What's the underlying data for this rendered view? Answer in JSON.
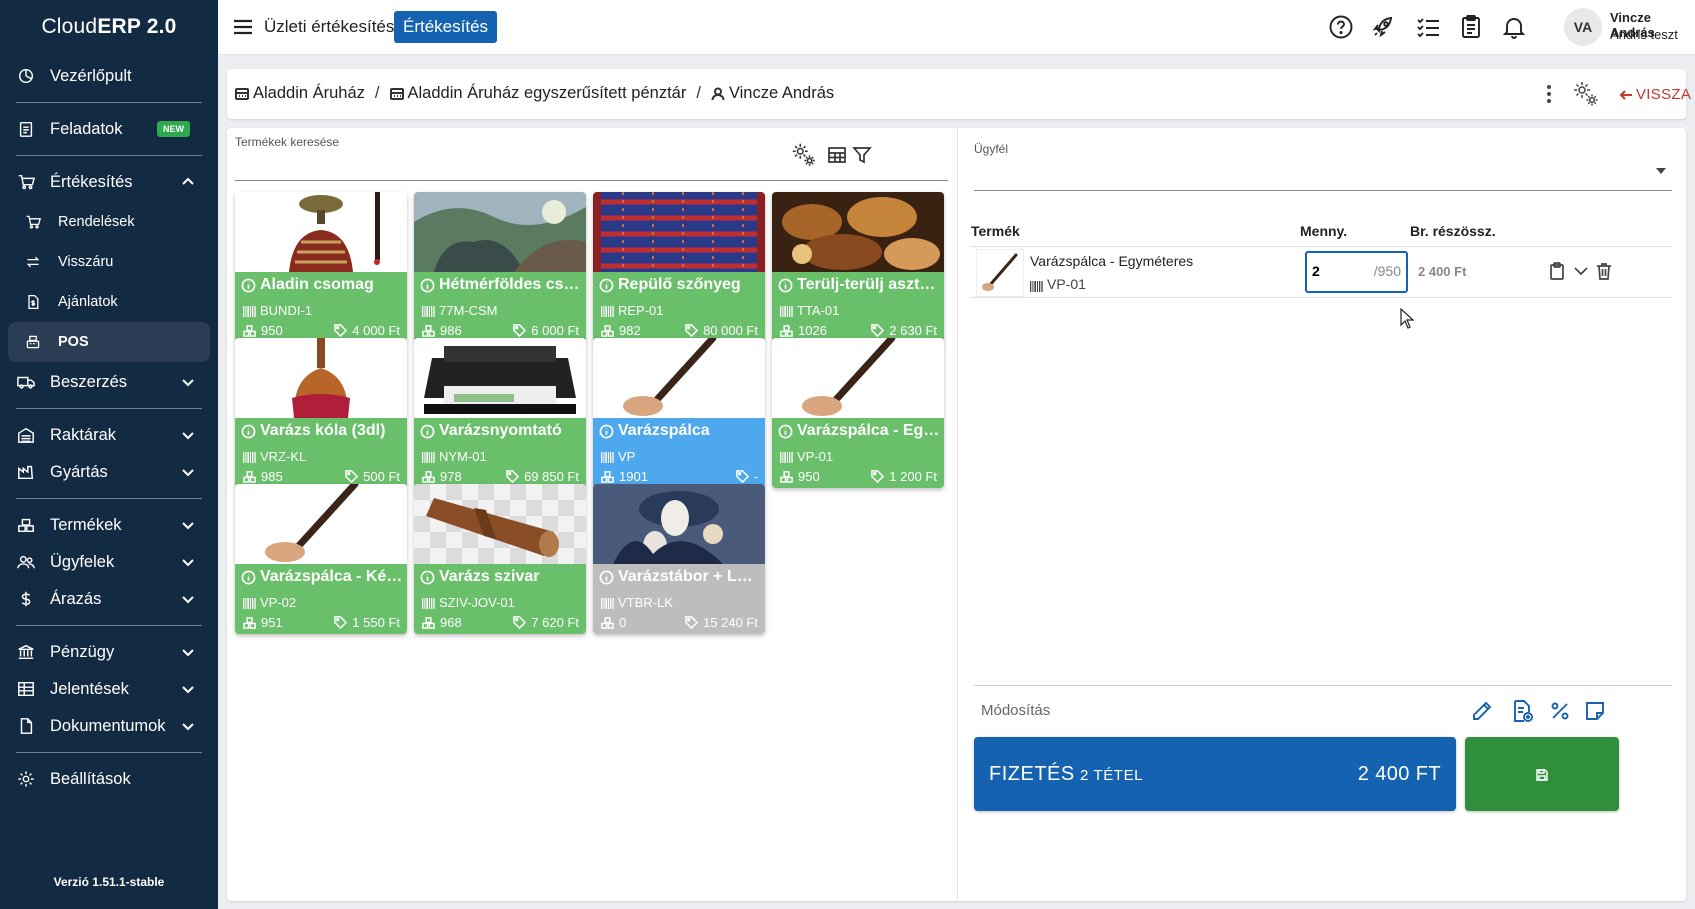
{
  "sidebar": {
    "brand_prefix": "Cloud",
    "brand_bold": "ERP 2.0",
    "items": {
      "dashboard": "Vezérlőpult",
      "tasks": "Feladatok",
      "tasks_badge": "NEW",
      "sales": "Értékesítés",
      "orders": "Rendelések",
      "returns": "Visszáru",
      "quotes": "Ajánlatok",
      "pos": "POS",
      "purchasing": "Beszerzés",
      "warehouses": "Raktárak",
      "manufacturing": "Gyártás",
      "products": "Termékek",
      "customers": "Ügyfelek",
      "pricing": "Árazás",
      "finance": "Pénzügy",
      "reports": "Jelentések",
      "documents": "Dokumentumok",
      "settings": "Beállítások"
    },
    "version": "Verzió 1.51.1-stable"
  },
  "topbar": {
    "title": "Üzleti értékesítés",
    "pill": "Értékesítés",
    "avatar_initials": "VA",
    "user_name": "Vincze András",
    "user_sub": "Andris teszt"
  },
  "breadcrumb": {
    "store": "Aladdin Áruház",
    "register": "Aladdin Áruház egyszerűsített pénztár",
    "user": "Vincze András",
    "back": "VISSZA"
  },
  "search": {
    "label": "Termékek keresése",
    "value": ""
  },
  "products": [
    {
      "name": "Aladin csomag",
      "sku": "BUNDI-1",
      "stock": "950",
      "price": "4 000 Ft",
      "status": "green"
    },
    {
      "name": "Hétmérföldes csizma",
      "sku": "77M-CSM",
      "stock": "986",
      "price": "6 000 Ft",
      "status": "green"
    },
    {
      "name": "Repülő szőnyeg",
      "sku": "REP-01",
      "stock": "982",
      "price": "80 000 Ft",
      "status": "green"
    },
    {
      "name": "Terülj-terülj asztalkám",
      "sku": "TTA-01",
      "stock": "1026",
      "price": "2 630 Ft",
      "status": "green"
    },
    {
      "name": "Varázs kóla (3dl)",
      "sku": "VRZ-KL",
      "stock": "985",
      "price": "500 Ft",
      "status": "green"
    },
    {
      "name": "Varázsnyomtató",
      "sku": "NYM-01",
      "stock": "978",
      "price": "69 850 Ft",
      "status": "green"
    },
    {
      "name": "Varázspálca",
      "sku": "VP",
      "stock": "1901",
      "price": "-",
      "status": "blue"
    },
    {
      "name": "Varázspálca - Egyméteres",
      "sku": "VP-01",
      "stock": "950",
      "price": "1 200 Ft",
      "status": "green"
    },
    {
      "name": "Varázspálca - Kétméteres",
      "sku": "VP-02",
      "stock": "951",
      "price": "1 550 Ft",
      "status": "green"
    },
    {
      "name": "Varázs szivar",
      "sku": "SZIV-JOV-01",
      "stock": "968",
      "price": "7 620 Ft",
      "status": "green"
    },
    {
      "name": "Varázstábor + Lakoma",
      "sku": "VTBR-LK",
      "stock": "0",
      "price": "15 240 Ft",
      "status": "gray"
    }
  ],
  "customer": {
    "label": "Ügyfél",
    "value": ""
  },
  "cart": {
    "headers": {
      "product": "Termék",
      "qty": "Menny.",
      "subtotal": "Br. részössz."
    },
    "items": [
      {
        "name": "Varázspálca - Egyméteres",
        "sku": "VP-01",
        "qty": "2",
        "max": "/950",
        "subtotal": "2 400 Ft"
      }
    ]
  },
  "modify_label": "Módosítás",
  "payment": {
    "label": "FIZETÉS",
    "count": "2 TÉTEL",
    "total": "2 400 FT"
  },
  "colors": {
    "sidebar_bg": "#132a43",
    "primary": "#1562b0",
    "card_green": "#6abf6b",
    "card_blue": "#4ea8ee",
    "card_gray": "#bdbdbd",
    "save_green": "#2f8f3a",
    "back_red": "#c0392b"
  }
}
